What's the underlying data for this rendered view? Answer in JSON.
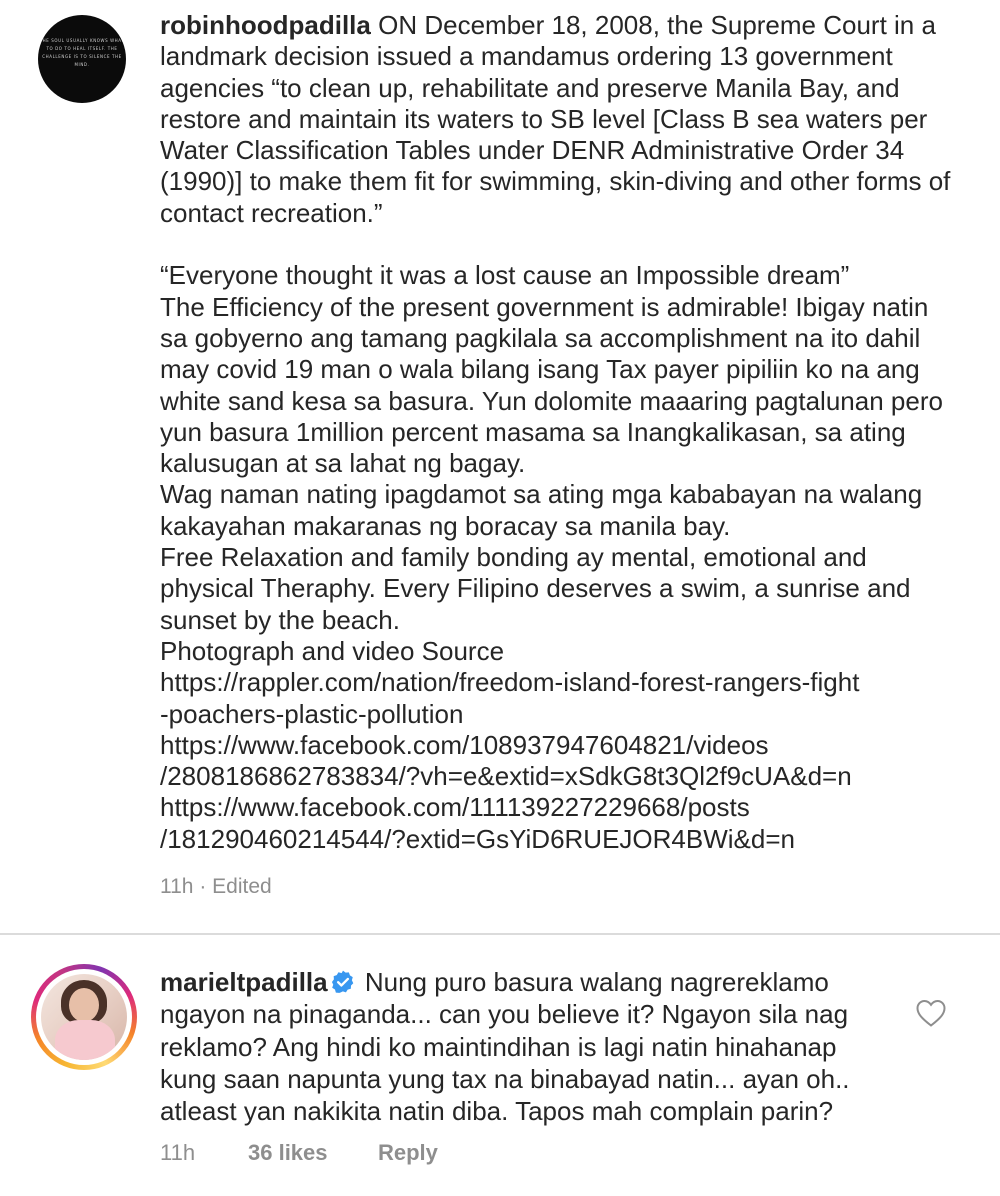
{
  "post": {
    "username": "robinhoodpadilla",
    "avatar_text": "THE SOUL USUALLY KNOWS WHAT TO DO TO HEAL ITSELF. THE CHALLENGE IS TO SILENCE THE MIND.",
    "caption": "ON December 18, 2008, the Supreme Court in a landmark decision issued a mandamus ordering 13 government agencies “to clean up, rehabilitate and preserve Manila Bay, and restore and maintain its waters to SB level [Class B sea waters per Water Classification Tables under DENR Administrative Order 34 (1990)] to make them fit for swimming, skin-diving and other forms of contact recreation.”\n\n“Everyone thought it was a lost cause an Impossible dream”\nThe Efficiency of the present government is admirable! Ibigay natin sa gobyerno ang tamang pagkilala sa accomplishment na ito dahil may covid 19 man o wala bilang isang Tax payer pipiliin ko na ang white sand kesa sa basura. Yun dolomite maaaring pagtalunan pero yun basura 1million percent masama sa Inangkalikasan, sa ating kalusugan at sa lahat ng bagay.\nWag naman nating ipagdamot sa ating mga kababayan na walang kakayahan makaranas ng boracay sa manila bay.\nFree Relaxation and family bonding ay mental, emotional and physical Theraphy. Every Filipino deserves a swim, a sunrise and sunset by the beach.\nPhotograph and video Source\nhttps://rappler.com/nation/freedom-island-forest-rangers-fight\n-poachers-plastic-pollution\nhttps://www.facebook.com/108937947604821/videos\n/2808186862783834/?vh=e&extid=xSdkG8t3Ql2f9cUA&d=n\nhttps://www.facebook.com/111139227229668/posts\n/181290460214544/?extid=GsYiD6RUEJOR4BWi&d=n",
    "meta": "11h · Edited"
  },
  "comment": {
    "username": "marieltpadilla",
    "verified_icon": "verified-badge-icon",
    "text": "Nung puro basura walang nagrereklamo ngayon na pinaganda... can you believe it? Ngayon sila nag reklamo? Ang hindi ko maintindihan is lagi natin hinahanap kung saan napunta yung tax na binabayad natin... ayan oh.. atleast yan nakikita natin diba. Tapos mah complain parin?",
    "time": "11h",
    "likes": "36 likes",
    "reply_label": "Reply",
    "like_icon": "heart-icon"
  },
  "colors": {
    "text": "#262626",
    "meta": "#8e8e8e",
    "verified": "#3897f0",
    "divider": "#dbdbdb"
  }
}
